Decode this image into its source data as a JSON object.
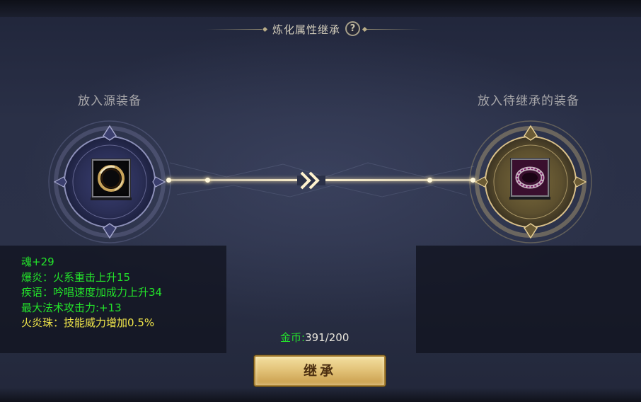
{
  "header": {
    "title": "炼化属性继承",
    "help_icon": "question-mark-icon"
  },
  "source_slot": {
    "label": "放入源装备",
    "item_icon": "gold-ring-icon"
  },
  "target_slot": {
    "label": "放入待继承的装备",
    "item_icon": "purple-bracelet-icon"
  },
  "connector": {
    "icon": "double-chevron-right-icon"
  },
  "attributes": [
    {
      "text": "魂+29"
    },
    {
      "text": "爆炎：火系重击上升15"
    },
    {
      "text": "疾语：吟唱速度加成力上升34"
    },
    {
      "text": "最大法术攻击力:+13"
    },
    {
      "text": "火炎珠：技能威力增加0.5%"
    }
  ],
  "cost": {
    "label": "金币:",
    "value": "391/200"
  },
  "action": {
    "label": "继承"
  },
  "colors": {
    "attr_green": "#23e22a",
    "attr_yellow": "#f1e64a",
    "gold": "#e3c47a"
  }
}
